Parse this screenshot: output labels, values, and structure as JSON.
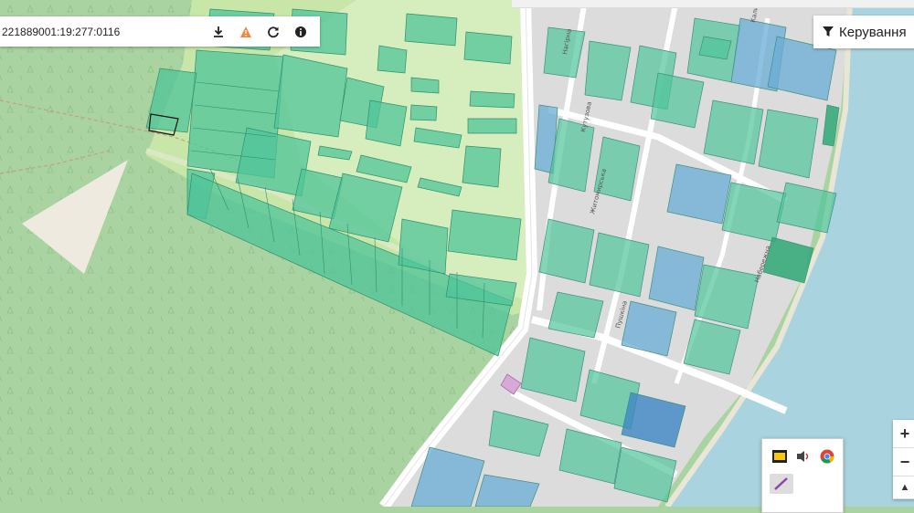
{
  "toolbar": {
    "cadastral_number": "221889001:19:277:0116",
    "icons": [
      "download-icon",
      "warning-icon",
      "refresh-icon",
      "info-icon"
    ]
  },
  "filter_button": {
    "label": "Керування"
  },
  "zoom": {
    "in": "+",
    "out": "−",
    "north": "▲"
  },
  "tray": {
    "icons": [
      "s3-icon",
      "speaker-icon",
      "chrome-icon",
      "pen-icon"
    ]
  },
  "map": {
    "streets": [
      "Житомирська",
      "Кутузова",
      "Набережна",
      "Пушкіна",
      "Нагірна",
      "Калинова"
    ],
    "colors": {
      "forest": "#a9d3a0",
      "meadow": "#c7e6a8",
      "parcel": "#4fc49a",
      "parcel_blue": "#6aaed6",
      "road": "#ffffff",
      "water": "#a9d3df",
      "residential": "#dcdcdc"
    }
  }
}
